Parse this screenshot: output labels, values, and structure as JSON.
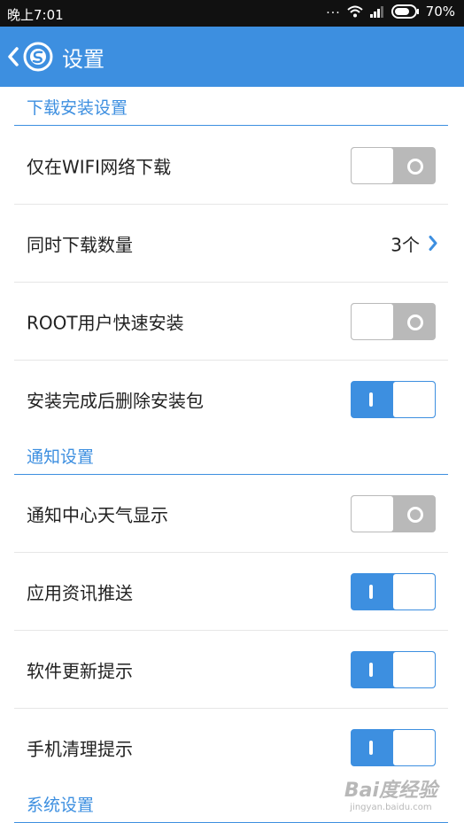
{
  "status_bar": {
    "time": "晚上7:01",
    "dots": "...",
    "battery": "70%"
  },
  "app_bar": {
    "title": "设置"
  },
  "sections": {
    "download": {
      "title": "下载安装设置",
      "items": [
        {
          "label": "仅在WIFI网络下载",
          "toggle": "off"
        },
        {
          "label": "同时下载数量",
          "value": "3个"
        },
        {
          "label": "ROOT用户快速安装",
          "toggle": "off"
        },
        {
          "label": "安装完成后删除安装包",
          "toggle": "on"
        }
      ]
    },
    "notify": {
      "title": "通知设置",
      "items": [
        {
          "label": "通知中心天气显示",
          "toggle": "off"
        },
        {
          "label": "应用资讯推送",
          "toggle": "on"
        },
        {
          "label": "软件更新提示",
          "toggle": "on"
        },
        {
          "label": "手机清理提示",
          "toggle": "on"
        }
      ]
    },
    "system": {
      "title": "系统设置"
    }
  },
  "watermark": {
    "brand": "Bai度经验",
    "url": "jingyan.baidu.com"
  },
  "colors": {
    "accent": "#3d8fe0",
    "toggle_off": "#b9b9b9",
    "status_bar": "#111111"
  }
}
